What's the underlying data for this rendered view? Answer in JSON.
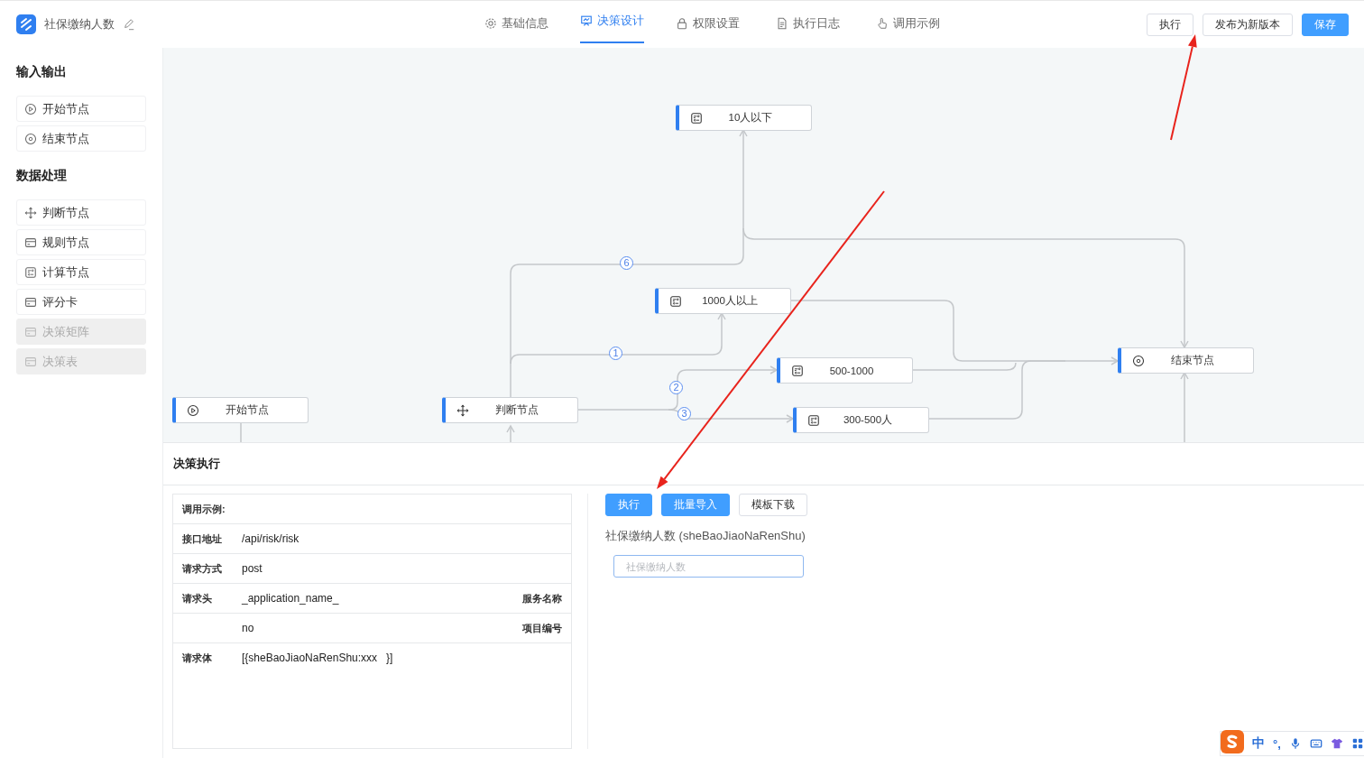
{
  "header": {
    "title": "社保缴纳人数",
    "tabs": [
      {
        "label": "基础信息",
        "kind": "gear",
        "selected": false
      },
      {
        "label": "决策设计",
        "kind": "board",
        "selected": true
      },
      {
        "label": "权限设置",
        "kind": "lock",
        "selected": false
      },
      {
        "label": "执行日志",
        "kind": "doc",
        "selected": false
      },
      {
        "label": "调用示例",
        "kind": "hand",
        "selected": false
      }
    ],
    "buttons": [
      {
        "label": "执行",
        "primary": false
      },
      {
        "label": "发布为新版本",
        "primary": false
      },
      {
        "label": "保存",
        "primary": true
      }
    ]
  },
  "sidebar": {
    "sections": [
      {
        "title": "输入输出",
        "items": [
          {
            "label": "开始节点",
            "kind": "play",
            "disabled": false
          },
          {
            "label": "结束节点",
            "kind": "stop",
            "disabled": false
          }
        ]
      },
      {
        "title": "数据处理",
        "items": [
          {
            "label": "判断节点",
            "kind": "move",
            "disabled": false
          },
          {
            "label": "规则节点",
            "kind": "card",
            "disabled": false
          },
          {
            "label": "计算节点",
            "kind": "calc",
            "disabled": false
          },
          {
            "label": "评分卡",
            "kind": "card",
            "disabled": false
          },
          {
            "label": "决策矩阵",
            "kind": "card",
            "disabled": true
          },
          {
            "label": "决策表",
            "kind": "card",
            "disabled": true
          }
        ]
      }
    ]
  },
  "canvas": {
    "nodes": [
      {
        "label": "10人以下",
        "kind": "calc"
      },
      {
        "label": "1000人以上",
        "kind": "calc"
      },
      {
        "label": "结束节点",
        "kind": "stop"
      },
      {
        "label": "500-1000",
        "kind": "calc"
      },
      {
        "label": "开始节点",
        "kind": "play"
      },
      {
        "label": "判断节点",
        "kind": "move"
      },
      {
        "label": "300-500人",
        "kind": "calc"
      }
    ],
    "edge_labels": [
      "6",
      "1",
      "2",
      "3"
    ]
  },
  "execution": {
    "title": "决策执行",
    "example": {
      "title": "调用示例:",
      "rows": [
        {
          "label": "接口地址",
          "value": "/api/risk/risk"
        },
        {
          "label": "请求方式",
          "value": "post"
        },
        {
          "label": "请求头",
          "value": "_application_name_",
          "note": "服务名称"
        },
        {
          "value": "no",
          "note": "项目编号"
        }
      ],
      "body": {
        "label": "请求体",
        "value": "[{sheBaoJiaoNaRenShu:xxx   }]"
      }
    },
    "buttons": [
      {
        "label": "执行",
        "primary": true
      },
      {
        "label": "批量导入",
        "primary": true
      },
      {
        "label": "模板下载",
        "primary": false
      }
    ],
    "field": {
      "label": "社保缴纳人数 (sheBaoJiaoNaRenShu)",
      "placeholder": "社保缴纳人数"
    }
  },
  "ime_toolbar": {
    "mode": "中",
    "punctuation": "°,"
  }
}
